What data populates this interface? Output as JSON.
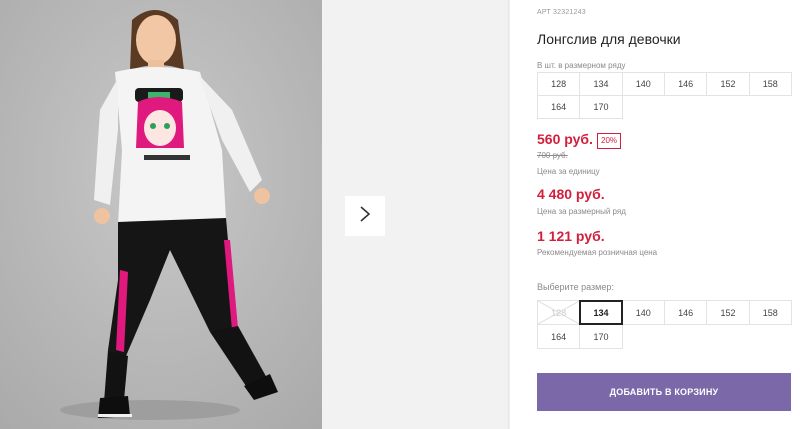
{
  "product": {
    "article": "АРТ 32321243",
    "title": "Лонгслив для девочки",
    "image_alt": "Girl wearing white longsleeve with anime print and black pants with pink stripes"
  },
  "size_row": {
    "caption": "В шт. в размерном ряду",
    "sizes": [
      "128",
      "134",
      "140",
      "146",
      "152",
      "158",
      "164",
      "170"
    ]
  },
  "pricing": {
    "price": "560 руб.",
    "discount": "20%",
    "old_price": "700 руб.",
    "price_caption": "Цена за единицу",
    "row_price": "4 480 руб.",
    "row_price_caption": "Цена за размерный ряд",
    "retail_price": "1 121 руб.",
    "retail_price_caption": "Рекомендуемая розничная цена"
  },
  "size_select": {
    "caption": "Выберите размер:",
    "sizes": [
      "128",
      "134",
      "140",
      "146",
      "152",
      "158",
      "164",
      "170"
    ],
    "selected": "134",
    "unavailable": [
      "128"
    ]
  },
  "cart": {
    "button_label": "ДОБАВИТЬ В КОРЗИНУ"
  },
  "gallery": {
    "next_icon": "chevron-right-icon"
  },
  "colors": {
    "price": "#d21f3c",
    "button": "#7a68a8"
  }
}
